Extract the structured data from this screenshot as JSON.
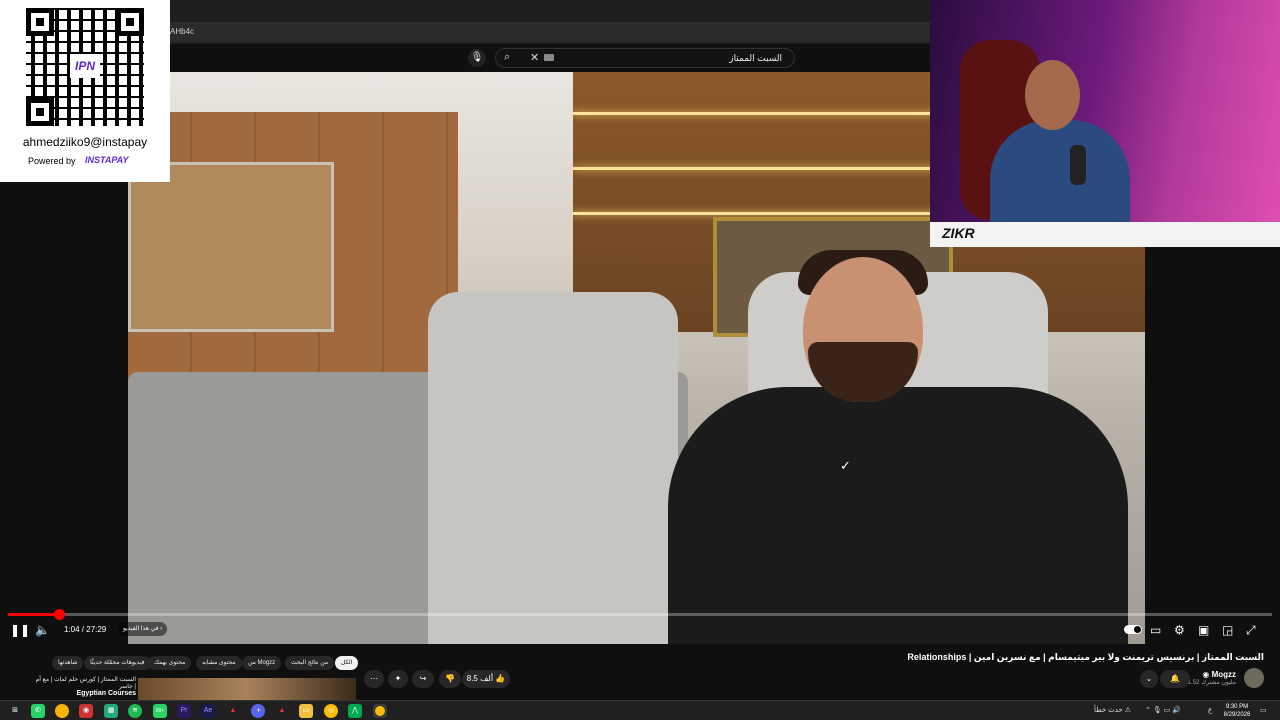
{
  "browser": {
    "url_fragment": "AHb4c"
  },
  "search": {
    "query": "السبت الممتاز"
  },
  "overlay_instapay": {
    "handle": "ahmedziiko9@instapay",
    "powered_by": "Powered by",
    "brand": "INSTAPAY",
    "qr_logo": "IPN"
  },
  "webcam": {
    "banner_text": "ZIKR"
  },
  "player": {
    "current_time": "1:04",
    "duration": "27:29",
    "time_display": "1:04 / 27:29",
    "chapter_label": "في هذا الفيديو",
    "progress_fraction": 0.04,
    "colors": {
      "progress": "#ff0000",
      "accent": "#ffffff"
    }
  },
  "video": {
    "title": "السبت الممتاز | برنسيس تريمنت ولا بير ميتيمسام | مع نسرين امين | Relationships",
    "channel": "Mogzz",
    "subscribers": "1.52 مليون مشترك",
    "likes": "8.5 ألف"
  },
  "chips": [
    "الكل",
    "من نتائج البحث",
    "من Mogzz",
    "محتوى مشابه",
    "محتوى يهمك",
    "فيديوهات محمّلة حديثًا",
    "شاهدتها"
  ],
  "recommendation": {
    "title": "السبت الممتاز | كورس حلم لمات | مع أم جاسر |",
    "channel": "Egyptian Courses"
  },
  "taskbar": {
    "tray_status": "حدث خطأ",
    "lang": "ع",
    "time": "9:30 PM",
    "date": "8/29/2026",
    "badge": "99+"
  }
}
